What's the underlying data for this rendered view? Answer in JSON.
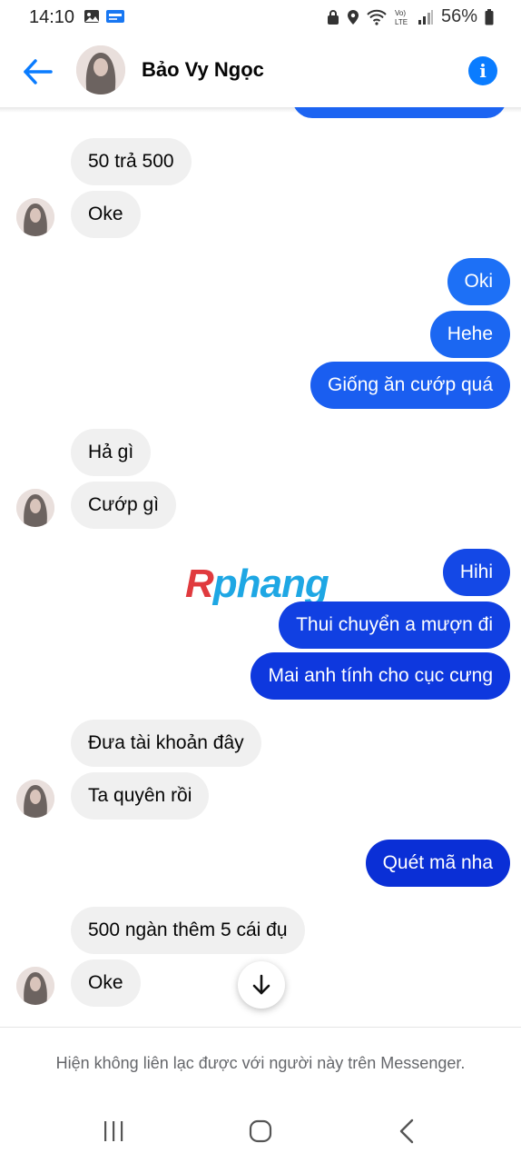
{
  "status_bar": {
    "time": "14:10",
    "battery": "56%",
    "icons_left": [
      "gallery-icon",
      "app-notification-icon"
    ],
    "icons_right": [
      "lock-icon",
      "location-icon",
      "wifi-icon",
      "volte-icon",
      "signal-icon",
      "battery-icon"
    ]
  },
  "header": {
    "contact_name": "Bảo Vy Ngọc",
    "back_icon": "arrow-left-icon",
    "info_icon": "info-icon",
    "info_glyph": "i"
  },
  "colors": {
    "accent": "#0a7cff",
    "incoming_bubble": "#f0f0f0",
    "outgoing_light": "#1c6bf5",
    "outgoing_dark": "#0a2fd6"
  },
  "messages": {
    "m1": "50 trả 500",
    "m2": "Oke",
    "m3": "Oki",
    "m4": "Hehe",
    "m5": "Giống ăn cướp quá",
    "m6": "Hả gì",
    "m7": "Cướp gì",
    "m8": "Hihi",
    "m9": "Thui chuyển a mượn đi",
    "m10": "Mai anh tính cho cục cưng",
    "m11": "Đưa tài khoản đây",
    "m12": "Ta quyên rồi",
    "m13": "Quét mã nha",
    "m14": "500 ngàn thêm 5 cái đụ",
    "m15": "Oke"
  },
  "watermark": {
    "first": "R",
    "rest": "phang"
  },
  "footer": {
    "notice": "Hiện không liên lạc được với người này trên Messenger."
  },
  "nav": [
    "recents-icon",
    "home-icon",
    "back-icon"
  ]
}
